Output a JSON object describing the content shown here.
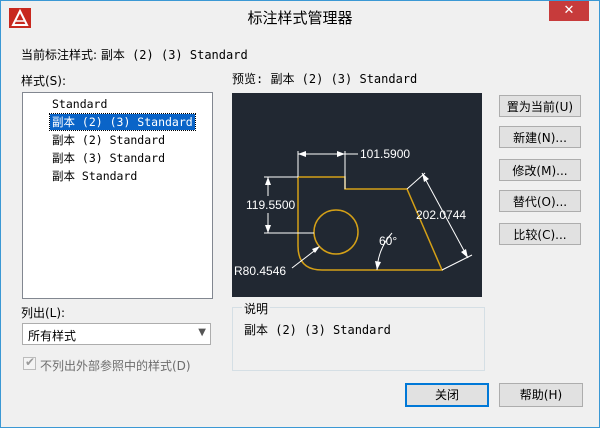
{
  "window": {
    "title": "标注样式管理器",
    "close_glyph": "✕"
  },
  "current_style": {
    "label": "当前标注样式: ",
    "value": "副本 (2) (3) Standard"
  },
  "styles": {
    "label": "样式(S):",
    "items": [
      "Standard",
      "副本 (2) (3) Standard",
      "副本 (2) Standard",
      "副本 (3) Standard",
      "副本 Standard"
    ],
    "selected_index": 1
  },
  "preview": {
    "label": "预览: 副本 (2) (3) Standard",
    "dims": [
      "101.5900",
      "119.5500",
      "202.0744",
      "60°",
      "R80.4546"
    ]
  },
  "buttons": {
    "set_current": "置为当前(U)",
    "new": "新建(N)...",
    "modify": "修改(M)...",
    "override": "替代(O)...",
    "compare": "比较(C)..."
  },
  "list": {
    "label": "列出(L):",
    "selected": "所有样式"
  },
  "exclude_xref": {
    "label": "不列出外部参照中的样式(D)",
    "checked": true
  },
  "description": {
    "label": "说明",
    "text": "副本 (2) (3) Standard"
  },
  "bottom": {
    "close": "关闭",
    "help": "帮助(H)"
  },
  "colors": {
    "accent": "#0a64c8",
    "preview_bg": "#212832",
    "geometry": "#d4a017",
    "dim_line": "#ffffff"
  }
}
